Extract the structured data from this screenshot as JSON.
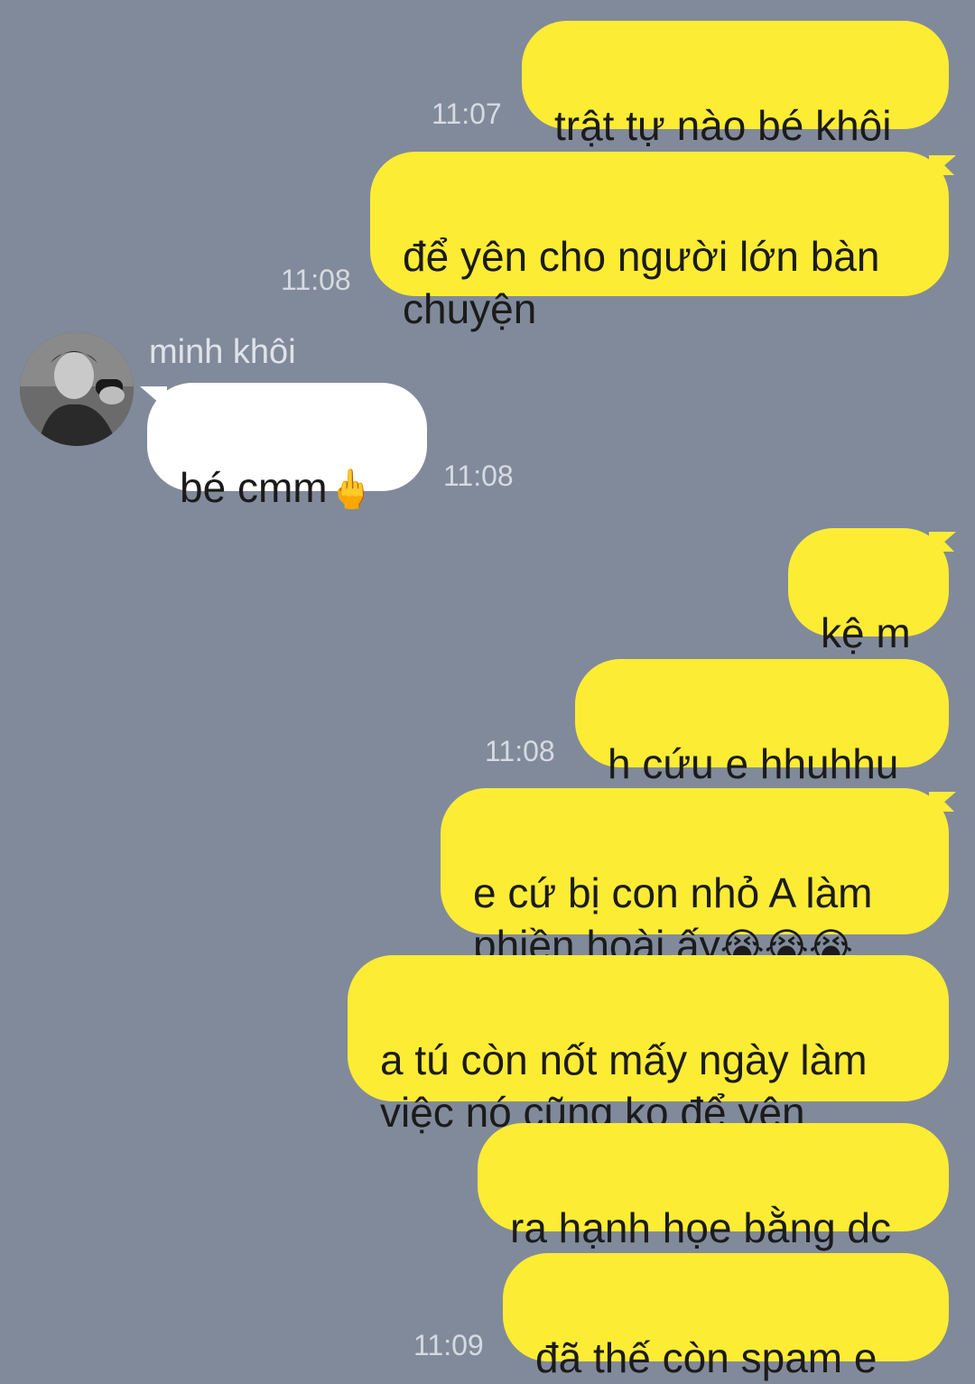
{
  "contact": {
    "name": "minh khôi"
  },
  "messages": [
    {
      "text": "trật tự nào bé khôi",
      "time": "11:07"
    },
    {
      "text": "để yên cho người lớn bàn\nchuyện",
      "time": "11:08"
    },
    {
      "text": "bé cmm",
      "emoji": "🖕",
      "time": "11:08"
    },
    {
      "text": "kệ m"
    },
    {
      "text": "h cứu e hhuhhu",
      "time": "11:08"
    },
    {
      "text": "e cứ bị con nhỏ A làm\nphiền hoài ấy",
      "emoji": "😭😭😭"
    },
    {
      "text": "a tú còn nốt mấy ngày làm\nviệc nó cũng ko để yên"
    },
    {
      "text": "ra hạnh họe bằng dc"
    },
    {
      "text": "đã thế còn spam e",
      "time": "11:09"
    }
  ],
  "colors": {
    "background": "#818a9b",
    "outgoing_bubble": "#fdec34",
    "incoming_bubble": "#ffffff",
    "timestamp": "#d6dae2"
  }
}
